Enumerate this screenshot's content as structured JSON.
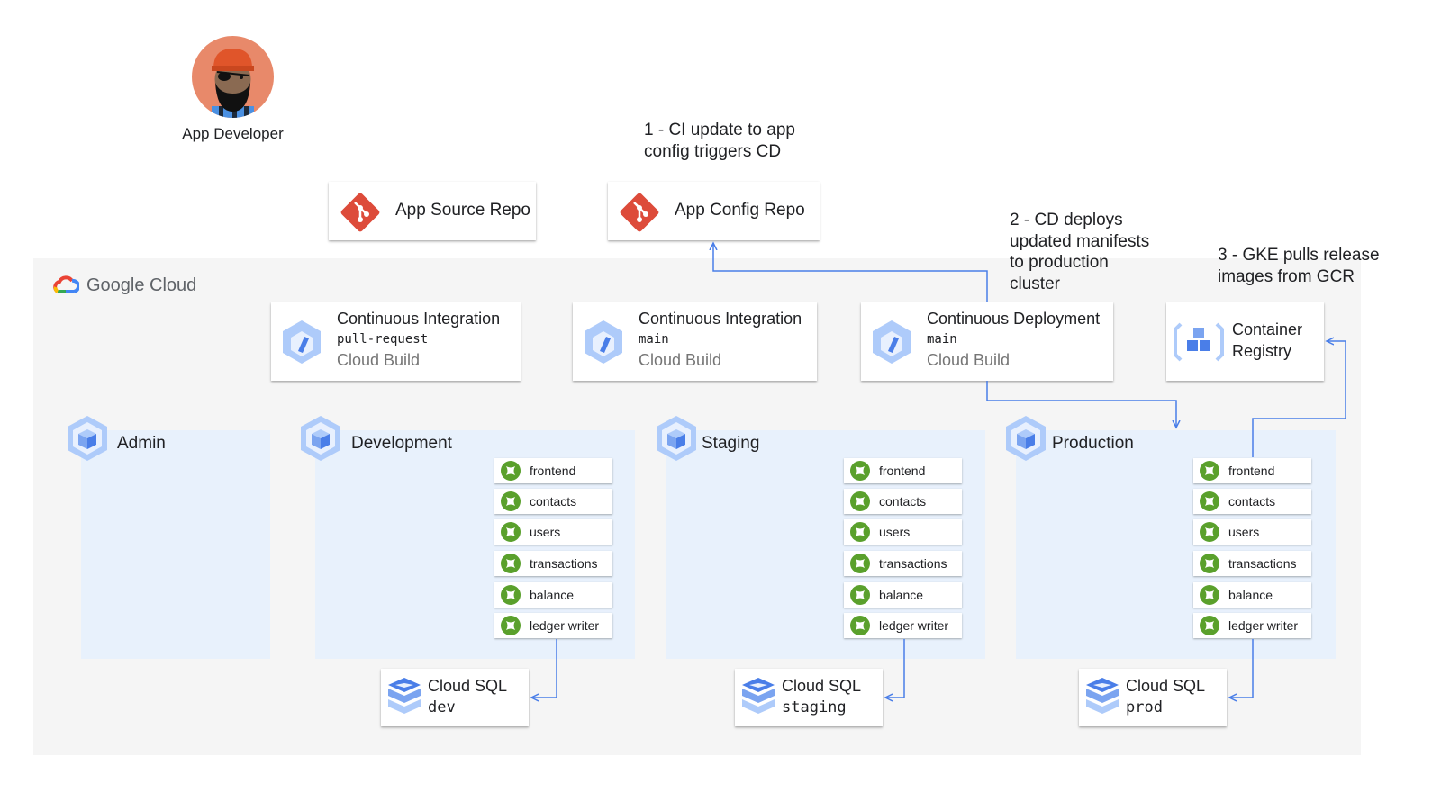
{
  "actor": {
    "label": "App Developer",
    "icon": "developer-avatar-icon"
  },
  "annotations": {
    "step1": [
      "1 - CI update to app",
      "config triggers CD"
    ],
    "step2": [
      "2 - CD deploys",
      "updated manifests",
      "to production",
      "cluster"
    ],
    "step3": [
      "3 - GKE pulls release",
      "images from GCR"
    ]
  },
  "repos": [
    {
      "label": "App Source Repo",
      "icon": "git-icon"
    },
    {
      "label": "App Config Repo",
      "icon": "git-icon"
    }
  ],
  "cloud": {
    "brand": "Google Cloud",
    "icon": "google-cloud-logo-icon"
  },
  "builds": [
    {
      "title": "Continuous Integration",
      "branch": "pull-request",
      "product": "Cloud Build"
    },
    {
      "title": "Continuous Integration",
      "branch": "main",
      "product": "Cloud Build"
    },
    {
      "title": "Continuous Deployment",
      "branch": "main",
      "product": "Cloud Build"
    }
  ],
  "registry": {
    "line1": "Container",
    "line2": "Registry"
  },
  "environments": [
    {
      "name": "Admin",
      "services": []
    },
    {
      "name": "Development",
      "services": [
        "frontend",
        "contacts",
        "users",
        "transactions",
        "balance",
        "ledger writer"
      ],
      "db": {
        "product": "Cloud SQL",
        "instance": "dev"
      }
    },
    {
      "name": "Staging",
      "services": [
        "frontend",
        "contacts",
        "users",
        "transactions",
        "balance",
        "ledger writer"
      ],
      "db": {
        "product": "Cloud SQL",
        "instance": "staging"
      }
    },
    {
      "name": "Production",
      "services": [
        "frontend",
        "contacts",
        "users",
        "transactions",
        "balance",
        "ledger writer"
      ],
      "db": {
        "product": "Cloud SQL",
        "instance": "prod"
      }
    }
  ],
  "colors": {
    "arrow": "#4a7ee8",
    "env_bg": "#e8f1fc",
    "gcp_bg": "#f5f5f5",
    "git": "#dd4b3a",
    "pod": "#5aa02c",
    "product_blue": "#7ba4f0"
  }
}
